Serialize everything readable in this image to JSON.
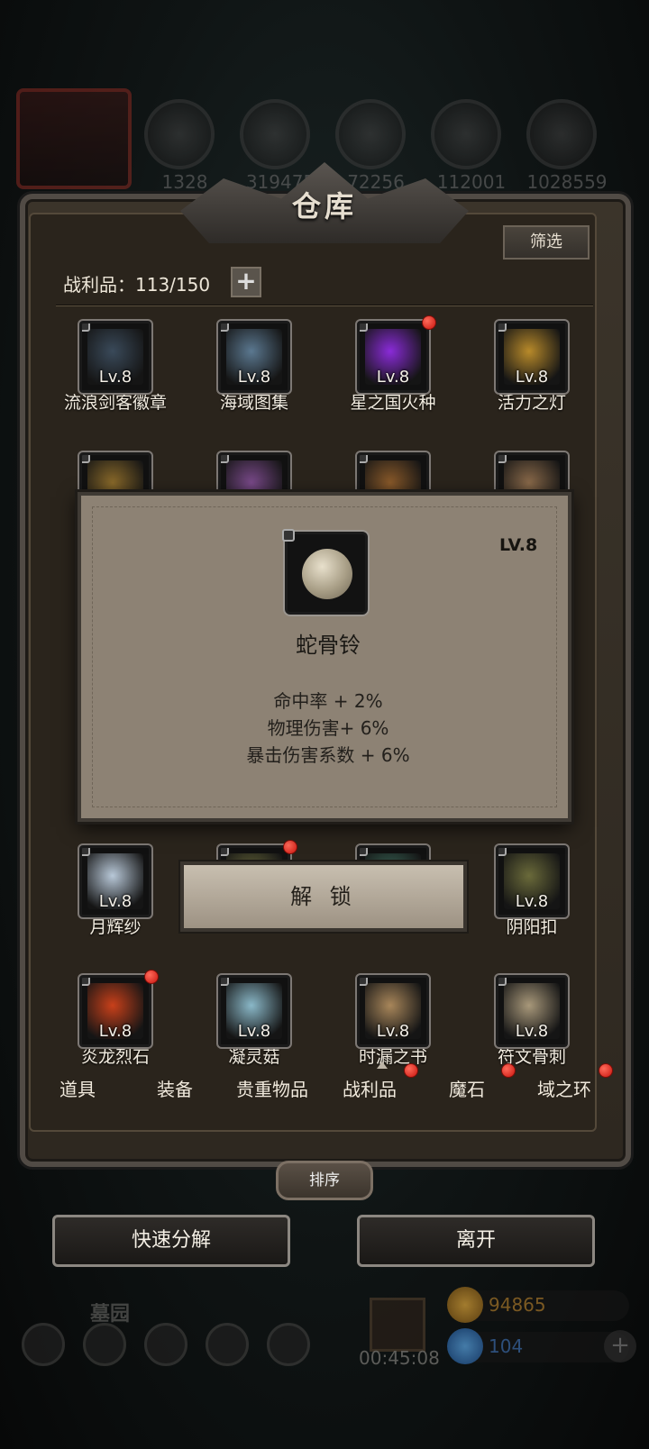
{
  "resources": {
    "values": [
      "1328",
      "319475",
      "72256",
      "112001",
      "1028559"
    ],
    "icons": [
      "ore-icon",
      "wood-icon",
      "stone-icon",
      "crystal-icon",
      "iron-icon"
    ]
  },
  "warehouse": {
    "title": "仓库",
    "filter_label": "筛选",
    "loot_label": "战利品：113/150",
    "plus_label": "+"
  },
  "items": [
    {
      "name": "流浪剑客徽章",
      "level": "Lv.8",
      "color": "#3a4a5a",
      "dot": false
    },
    {
      "name": "海域图集",
      "level": "Lv.8",
      "color": "#5b7890",
      "dot": false
    },
    {
      "name": "星之国火种",
      "level": "Lv.8",
      "color": "#8a2bd8",
      "dot": true
    },
    {
      "name": "活力之灯",
      "level": "Lv.8",
      "color": "#b88a2a",
      "dot": false
    },
    {
      "name": "",
      "level": "",
      "color": "#8a6a2a",
      "dot": false
    },
    {
      "name": "",
      "level": "",
      "color": "#7a4a8a",
      "dot": false
    },
    {
      "name": "",
      "level": "",
      "color": "#8a5a2a",
      "dot": false
    },
    {
      "name": "",
      "level": "",
      "color": "#8a6a4a",
      "dot": false
    },
    {
      "name": "月辉纱",
      "level": "Lv.8",
      "color": "#b8c8d8",
      "dot": false
    },
    {
      "name": "",
      "level": "",
      "color": "#6a6a3a",
      "dot": true
    },
    {
      "name": "",
      "level": "",
      "color": "#3a6a5a",
      "dot": false
    },
    {
      "name": "阴阳扣",
      "level": "Lv.8",
      "color": "#6a6a3a",
      "dot": false
    },
    {
      "name": "炎龙烈石",
      "level": "Lv.8",
      "color": "#c8401a",
      "dot": true
    },
    {
      "name": "凝灵菇",
      "level": "Lv.8",
      "color": "#8ab8c8",
      "dot": false
    },
    {
      "name": "时漏之书",
      "level": "Lv.8",
      "color": "#a8865a",
      "dot": false
    },
    {
      "name": "符文骨刺",
      "level": "Lv.8",
      "color": "#a8987a",
      "dot": false
    }
  ],
  "tabs": [
    {
      "label": "道具",
      "dot": false
    },
    {
      "label": "装备",
      "dot": false
    },
    {
      "label": "贵重物品",
      "dot": false
    },
    {
      "label": "战利品",
      "dot": true
    },
    {
      "label": "魔石",
      "dot": true
    },
    {
      "label": "域之环",
      "dot": true
    }
  ],
  "buttons": {
    "sort": "排序",
    "quick_decompose": "快速分解",
    "leave": "离开",
    "unlock": "解 锁"
  },
  "popup": {
    "level": "LV.8",
    "name": "蛇骨铃",
    "stats": [
      "命中率 + 2%",
      "物理伤害+ 6%",
      "暴击伤害系数 + 6%"
    ]
  },
  "footer": {
    "location": "墓园",
    "timer": "00:45:08",
    "gold": "94865",
    "gems": "104",
    "plus": "+"
  }
}
